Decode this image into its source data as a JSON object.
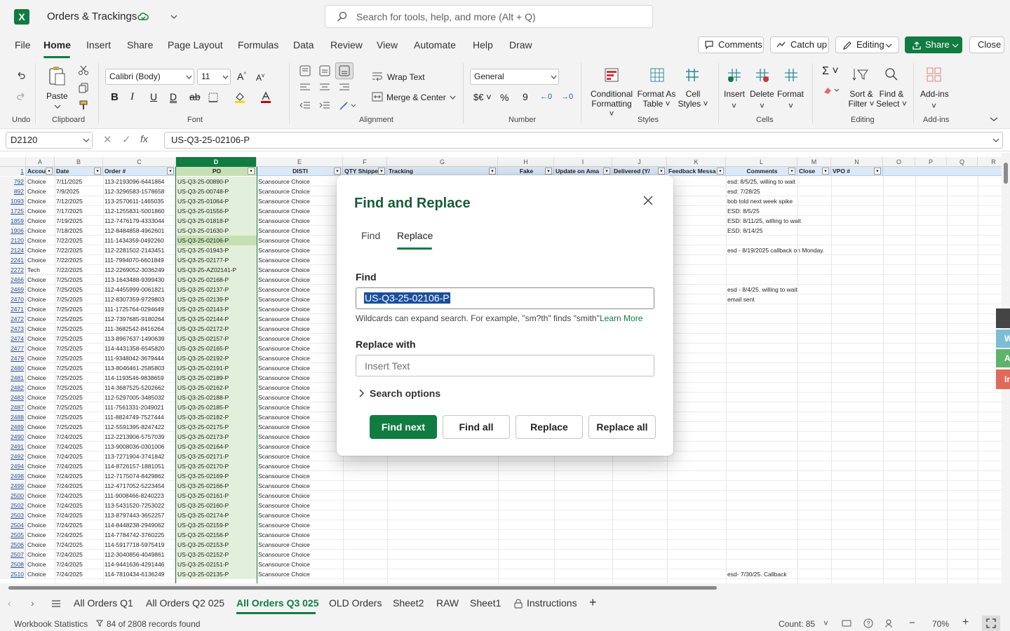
{
  "app": {
    "workbook": "Orders & Trackings",
    "search_placeholder": "Search for tools, help, and more (Alt + Q)"
  },
  "menu": [
    "File",
    "Home",
    "Insert",
    "Share",
    "Page Layout",
    "Formulas",
    "Data",
    "Review",
    "View",
    "Automate",
    "Help",
    "Draw"
  ],
  "top_buttons": {
    "comments": "Comments",
    "catchup": "Catch up",
    "editing": "Editing",
    "share": "Share",
    "close": "Close"
  },
  "ribbon": {
    "undo": "Undo",
    "clipboard": "Clipboard",
    "paste": "Paste",
    "font": "Font",
    "font_name": "Calibri (Body)",
    "font_size": "11",
    "alignment": "Alignment",
    "wrap": "Wrap Text",
    "merge": "Merge & Center",
    "number": "Number",
    "number_format": "General",
    "styles": "Styles",
    "cond": [
      "Conditional",
      "Formatting"
    ],
    "fmt_table": [
      "Format As",
      "Table"
    ],
    "cell_styles": [
      "Cell",
      "Styles"
    ],
    "cells": "Cells",
    "insert": "Insert",
    "delete": "Delete",
    "format": "Format",
    "editing": "Editing",
    "sort": [
      "Sort &",
      "Filter"
    ],
    "find": [
      "Find &",
      "Select"
    ],
    "addins": "Add-ins",
    "addins_lbl": "Add-ins"
  },
  "formula_bar": {
    "name_box": "D2120",
    "formula": "US-Q3-25-02106-P"
  },
  "columns": [
    "A",
    "B",
    "C",
    "D",
    "E",
    "F",
    "G",
    "H",
    "I",
    "J",
    "K",
    "L",
    "M",
    "N",
    "O",
    "P",
    "Q",
    "R"
  ],
  "header_row": {
    "num": "1",
    "cells": [
      "Accou",
      "Date",
      "Order #",
      "PO",
      "DISTI",
      "QTY Shippe",
      "Tracking",
      "Fake",
      "Update on Ama",
      "Delivered (Y/",
      "Feedback Messa",
      "Comments",
      "Close",
      "VPO #"
    ]
  },
  "rows": [
    [
      "792",
      "Choice",
      "7/11/2025",
      "113-2193096-6441864",
      "US-Q3-25-00890-P",
      "Scansource Choice",
      "esd: 8/5/25, willing to wait"
    ],
    [
      "892",
      "Choice",
      "7/9/2025",
      "112-3296583-1578658",
      "US-Q3-25-00748-P",
      "Scansource Choice",
      "esd: 7/28/25"
    ],
    [
      "1093",
      "Choice",
      "7/12/2025",
      "113-2570611-1465035",
      "US-Q3-25-01064-P",
      "Scansource Choice",
      "bob told next week spike"
    ],
    [
      "1725",
      "Choice",
      "7/17/2025",
      "112-1255831-5001860",
      "US-Q3-25-01556-P",
      "Scansource Choice",
      " ESD:  8/5/25"
    ],
    [
      "1859",
      "Choice",
      "7/19/2025",
      "112-7476179-4333044",
      "US-Q3-25-01818-P",
      "Scansource Choice",
      "ESD: 8/11/25, willing to wait"
    ],
    [
      "1906",
      "Choice",
      "7/18/2025",
      "112-8484858-4962601",
      "US-Q3-25-01630-P",
      "Scansource Choice",
      "ESD: 8/14/25"
    ],
    [
      "2120",
      "Choice",
      "7/22/2025",
      "111-1434359-0492260",
      "US-Q3-25-02106-P",
      "Scansource Choice",
      ""
    ],
    [
      "2124",
      "Choice",
      "7/22/2025",
      "112-2281502-2143451",
      "US-Q3-25-01943-P",
      "Scansource Choice",
      "esd - 8/19/2025 callback on Monday."
    ],
    [
      "2241",
      "Choice",
      "7/22/2025",
      "111-7994070-6601849",
      "US-Q3-25-02177-P",
      "Scansource Choice",
      ""
    ],
    [
      "2272",
      "Tech",
      "7/22/2025",
      "112-2269052-3036249",
      "US-Q3-25-AZ02141-P",
      "Scansource Choice",
      ""
    ],
    [
      "2466",
      "Choice",
      "7/25/2025",
      "113-1643488-9399430",
      "US-Q3-25-02168-P",
      "Scansource Choice",
      ""
    ],
    [
      "2469",
      "Choice",
      "7/25/2025",
      "112-4455999-0061821",
      "US-Q3-25-02137-P",
      "Scansource Choice",
      "esd - 8/4/25. willing to wait"
    ],
    [
      "2470",
      "Choice",
      "7/25/2025",
      "112-8307359-9729803",
      "US-Q3-25-02139-P",
      "Scansource Choice",
      "email sent"
    ],
    [
      "2471",
      "Choice",
      "7/25/2025",
      "111-1725764-0294649",
      "US-Q3-25-02143-P",
      "Scansource Choice",
      ""
    ],
    [
      "2472",
      "Choice",
      "7/25/2025",
      "112-7397685-9180264",
      "US-Q3-25-02144-P",
      "Scansource Choice",
      ""
    ],
    [
      "2473",
      "Choice",
      "7/25/2025",
      "111-3682542-8416264",
      "US-Q3-25-02172-P",
      "Scansource Choice",
      ""
    ],
    [
      "2474",
      "Choice",
      "7/25/2025",
      "113-8967637-1490639",
      "US-Q3-25-02157-P",
      "Scansource Choice",
      ""
    ],
    [
      "2477",
      "Choice",
      "7/25/2025",
      "114-4431358-6545820",
      "US-Q3-25-02165-P",
      "Scansource Choice",
      ""
    ],
    [
      "2479",
      "Choice",
      "7/25/2025",
      "111-9348042-3679444",
      "US-Q3-25-02192-P",
      "Scansource Choice",
      ""
    ],
    [
      "2480",
      "Choice",
      "7/25/2025",
      "113-8046461-2585803",
      "US-Q3-25-02191-P",
      "Scansource Choice",
      ""
    ],
    [
      "2481",
      "Choice",
      "7/25/2025",
      "114-1193546-9838659",
      "US-Q3-25-02189-P",
      "Scansource Choice",
      ""
    ],
    [
      "2482",
      "Choice",
      "7/25/2025",
      "114-3687525-5202662",
      "US-Q3-25-02162-P",
      "Scansource Choice",
      ""
    ],
    [
      "2483",
      "Choice",
      "7/25/2025",
      "112-5297005-3485032",
      "US-Q3-25-02188-P",
      "Scansource Choice",
      ""
    ],
    [
      "2487",
      "Choice",
      "7/25/2025",
      "111-7561331-2049021",
      "US-Q3-25-02185-P",
      "Scansource Choice",
      ""
    ],
    [
      "2488",
      "Choice",
      "7/25/2025",
      "111-8824749-7527444",
      "US-Q3-25-02182-P",
      "Scansource Choice",
      ""
    ],
    [
      "2489",
      "Choice",
      "7/25/2025",
      "112-5591395-8247422",
      "US-Q3-25-02175-P",
      "Scansource Choice",
      ""
    ],
    [
      "2490",
      "Choice",
      "7/24/2025",
      "112-2213906-5757039",
      "US-Q3-25-02173-P",
      "Scansource Choice",
      ""
    ],
    [
      "2491",
      "Choice",
      "7/24/2025",
      "113-9008036-0301006",
      "US-Q3-25-02164-P",
      "Scansource Choice",
      ""
    ],
    [
      "2492",
      "Choice",
      "7/24/2025",
      "113-7271904-3741842",
      "US-Q3-25-02171-P",
      "Scansource Choice",
      ""
    ],
    [
      "2494",
      "Choice",
      "7/24/2025",
      "114-8726157-1881051",
      "US-Q3-25-02170-P",
      "Scansource Choice",
      ""
    ],
    [
      "2498",
      "Choice",
      "7/24/2025",
      "112-7175074-8429862",
      "US-Q3-25-02169-P",
      "Scansource Choice",
      ""
    ],
    [
      "2499",
      "Choice",
      "7/24/2025",
      "112-4717052-5223454",
      "US-Q3-25-02166-P",
      "Scansource Choice",
      ""
    ],
    [
      "2500",
      "Choice",
      "7/24/2025",
      "111-9008466-8240223",
      "US-Q3-25-02161-P",
      "Scansource Choice",
      ""
    ],
    [
      "2502",
      "Choice",
      "7/24/2025",
      "113-5431520-7253022",
      "US-Q3-25-02160-P",
      "Scansource Choice",
      ""
    ],
    [
      "2503",
      "Choice",
      "7/24/2025",
      "113-8797443-3652257",
      "US-Q3-25-02174-P",
      "Scansource Choice",
      ""
    ],
    [
      "2504",
      "Choice",
      "7/24/2025",
      "114-8448238-2949062",
      "US-Q3-25-02159-P",
      "Scansource Choice",
      ""
    ],
    [
      "2505",
      "Choice",
      "7/24/2025",
      "114-7784742-3760225",
      "US-Q3-25-02156-P",
      "Scansource Choice",
      ""
    ],
    [
      "2506",
      "Choice",
      "7/24/2025",
      "114-5917718-5975419",
      "US-Q3-25-02153-P",
      "Scansource Choice",
      ""
    ],
    [
      "2507",
      "Choice",
      "7/24/2025",
      "112-3040856-4049861",
      "US-Q3-25-02152-P",
      "Scansource Choice",
      ""
    ],
    [
      "2508",
      "Choice",
      "7/24/2025",
      "114-9441636-4291446",
      "US-Q3-25-02151-P",
      "Scansource Choice",
      ""
    ],
    [
      "2510",
      "Choice",
      "7/24/2025",
      "114-7810434-6136249",
      "US-Q3-25-02135-P",
      "Scansource Choice",
      "esd- 7/30/25. Callback"
    ]
  ],
  "dialog": {
    "title": "Find and Replace",
    "tab_find": "Find",
    "tab_replace": "Replace",
    "find_label": "Find",
    "find_value": "US-Q3-25-02106-P",
    "hint": "Wildcards can expand search. For example, \"sm?th\" finds \"smith\".",
    "learn_more": "Learn More",
    "replace_label": "Replace with",
    "replace_placeholder": "Insert Text",
    "search_options": "Search options",
    "find_next": "Find next",
    "find_all": "Find all",
    "replace": "Replace",
    "replace_all": "Replace all"
  },
  "sheet_tabs": [
    "All Orders Q1",
    "All Orders Q2 025",
    "All Orders Q3 025",
    "OLD Orders",
    "Sheet2",
    "RAW",
    "Sheet1",
    "Instructions"
  ],
  "active_tab": "All Orders Q3 025",
  "status": {
    "workbook_stats": "Workbook Statistics",
    "records": "84 of 2808 records found",
    "count": "Count: 85",
    "zoom": "70%"
  },
  "colors": {
    "accent": "#107c41",
    "link": "#2b579a"
  }
}
